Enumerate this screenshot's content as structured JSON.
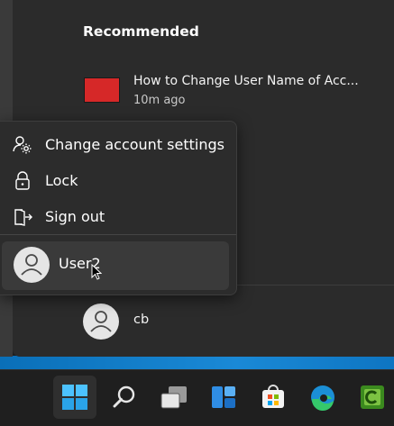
{
  "start_menu": {
    "recommended_title": "Recommended",
    "recommended_items": [
      {
        "title": "How to Change User Name of Acc...",
        "time": "10m ago",
        "thumb_color": "#d62828"
      }
    ],
    "footer_user": {
      "name": "cb",
      "icon": "person-icon"
    }
  },
  "account_menu": {
    "items": [
      {
        "label": "Change account settings",
        "icon": "account-settings-icon"
      },
      {
        "label": "Lock",
        "icon": "lock-icon"
      },
      {
        "label": "Sign out",
        "icon": "sign-out-icon"
      }
    ],
    "current_user": {
      "name": "User2",
      "icon": "person-icon"
    }
  },
  "taskbar": {
    "apps": [
      {
        "icon": "windows-start-icon",
        "active": true
      },
      {
        "icon": "search-icon"
      },
      {
        "icon": "task-view-icon"
      },
      {
        "icon": "widgets-icon"
      },
      {
        "icon": "microsoft-store-icon"
      },
      {
        "icon": "edge-icon"
      },
      {
        "icon": "camtasia-icon"
      }
    ]
  },
  "colors": {
    "menu_bg": "#2b2b2b",
    "popup_bg": "#2c2c2c",
    "accent": "#0078d4",
    "thumb_red": "#d62828"
  }
}
